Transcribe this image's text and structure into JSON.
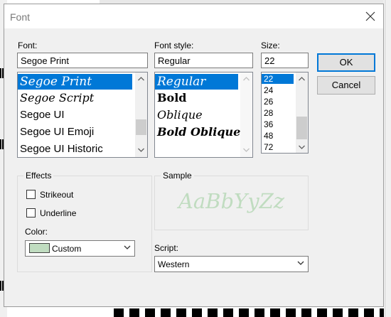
{
  "dialog": {
    "title": "Font"
  },
  "font": {
    "label": "Font:",
    "value": "Segoe Print",
    "items": [
      "Segoe Print",
      "Segoe Script",
      "Segoe UI",
      "Segoe UI Emoji",
      "Segoe UI Historic"
    ],
    "selected_index": 0
  },
  "style": {
    "label": "Font style:",
    "value": "Regular",
    "items": [
      "Regular",
      "Bold",
      "Oblique",
      "Bold Oblique"
    ],
    "selected_index": 0
  },
  "size": {
    "label": "Size:",
    "value": "22",
    "items": [
      "22",
      "24",
      "26",
      "28",
      "36",
      "48",
      "72"
    ],
    "selected_index": 0
  },
  "buttons": {
    "ok": "OK",
    "cancel": "Cancel"
  },
  "effects": {
    "title": "Effects",
    "strikeout": "Strikeout",
    "underline": "Underline",
    "strikeout_checked": false,
    "underline_checked": false,
    "color_label": "Color:",
    "color_value": "Custom",
    "color_swatch": "#c0dcc0"
  },
  "sample": {
    "title": "Sample",
    "text": "AaBbYyZz",
    "color": "#c0dcc0"
  },
  "script": {
    "label": "Script:",
    "value": "Western"
  },
  "colors": {
    "accent": "#0078d7",
    "dialog_bg": "#f0f0f0"
  }
}
